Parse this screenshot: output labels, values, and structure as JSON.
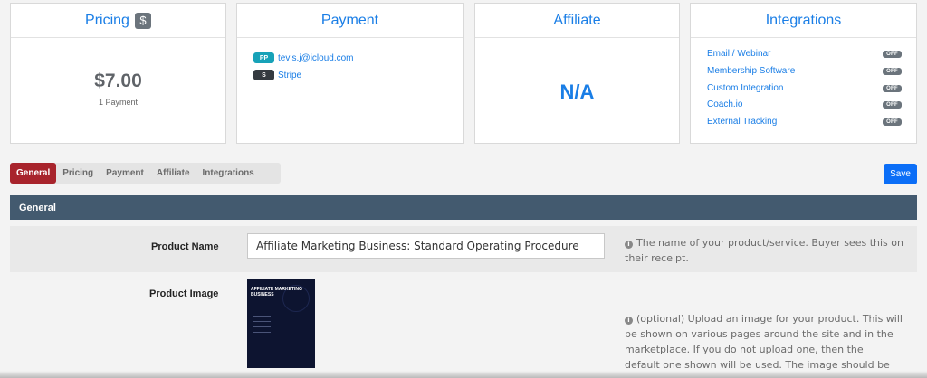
{
  "cards": {
    "pricing": {
      "title": "Pricing",
      "badge": "$",
      "price": "$7.00",
      "sub": "1 Payment"
    },
    "payment": {
      "title": "Payment",
      "methods": [
        {
          "badge": "PP",
          "label": "tevis.j@icloud.com",
          "color": "#17a2b8"
        },
        {
          "badge": "S",
          "label": "Stripe",
          "color": "#343a40"
        }
      ]
    },
    "affiliate": {
      "title": "Affiliate",
      "value": "N/A"
    },
    "integrations": {
      "title": "Integrations",
      "items": [
        {
          "label": "Email / Webinar",
          "status": "OFF"
        },
        {
          "label": "Membership Software",
          "status": "OFF"
        },
        {
          "label": "Custom Integration",
          "status": "OFF"
        },
        {
          "label": "Coach.io",
          "status": "OFF"
        },
        {
          "label": "External Tracking",
          "status": "OFF"
        }
      ]
    }
  },
  "tabs": [
    {
      "label": "General",
      "active": true
    },
    {
      "label": "Pricing",
      "active": false
    },
    {
      "label": "Payment",
      "active": false
    },
    {
      "label": "Affiliate",
      "active": false
    },
    {
      "label": "Integrations",
      "active": false
    }
  ],
  "save_label": "Save",
  "section_title": "General",
  "form": {
    "product_name": {
      "label": "Product Name",
      "value": "Affiliate Marketing Business: Standard Operating Procedure",
      "help_line1": "The name of your product/service. Buyer sees this on",
      "help_line2": "their receipt."
    },
    "product_image": {
      "label": "Product Image",
      "cover_title": "AFFILIATE MARKETING BUSINESS",
      "help_line1": "(optional) Upload an image for your product. This will",
      "help_line2": "be shown on various pages around the site and in the",
      "help_line3": "marketplace. If you do not upload one, then the",
      "help_line4": "default one shown will be used. The image should be"
    }
  },
  "colors": {
    "accent": "#1a7ee6",
    "tab_active": "#a8242c",
    "save": "#0b6ef7",
    "section_bar": "#435a6f"
  }
}
